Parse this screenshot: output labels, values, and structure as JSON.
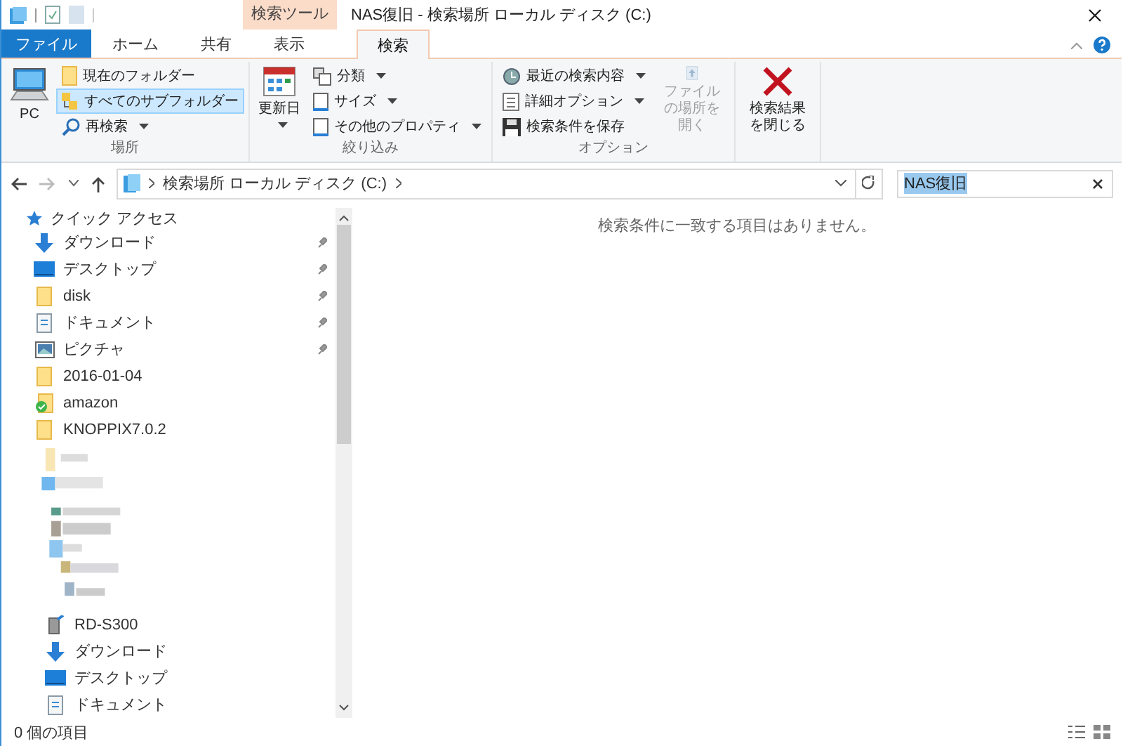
{
  "window": {
    "title": "NAS復旧 - 検索場所 ローカル ディスク (C:)",
    "context_tab": "検索ツール"
  },
  "tabs": [
    {
      "label": "ファイル",
      "kind": "file",
      "selected": false
    },
    {
      "label": "ホーム",
      "kind": "normal",
      "selected": false
    },
    {
      "label": "共有",
      "kind": "normal",
      "selected": false
    },
    {
      "label": "表示",
      "kind": "normal",
      "selected": false
    },
    {
      "label": "検索",
      "kind": "context",
      "selected": true
    }
  ],
  "ribbon": {
    "groups": [
      {
        "label": "場所",
        "buttons": [
          {
            "label": "PC",
            "kind": "large",
            "dropdown": false,
            "selected": false,
            "disabled": false
          },
          {
            "label": "現在のフォルダー",
            "kind": "small",
            "dropdown": false,
            "selected": false,
            "disabled": false
          },
          {
            "label": "すべてのサブフォルダー",
            "kind": "small",
            "dropdown": false,
            "selected": true,
            "disabled": false
          },
          {
            "label": "再検索",
            "kind": "small",
            "dropdown": true,
            "selected": false,
            "disabled": false
          }
        ]
      },
      {
        "label": "絞り込み",
        "buttons": [
          {
            "label": "更新日",
            "kind": "large",
            "dropdown": true,
            "selected": false,
            "disabled": false
          },
          {
            "label": "分類",
            "kind": "small",
            "dropdown": true,
            "selected": false,
            "disabled": false
          },
          {
            "label": "サイズ",
            "kind": "small",
            "dropdown": true,
            "selected": false,
            "disabled": false
          },
          {
            "label": "その他のプロパティ",
            "kind": "small",
            "dropdown": true,
            "selected": false,
            "disabled": false
          }
        ]
      },
      {
        "label": "オプション",
        "buttons": [
          {
            "label": "最近の検索内容",
            "kind": "small",
            "dropdown": true,
            "selected": false,
            "disabled": false
          },
          {
            "label": "詳細オプション",
            "kind": "small",
            "dropdown": true,
            "selected": false,
            "disabled": false
          },
          {
            "label": "検索条件を保存",
            "kind": "small",
            "dropdown": false,
            "selected": false,
            "disabled": false
          },
          {
            "label": "ファイルの場所を開く",
            "kind": "large",
            "dropdown": false,
            "selected": false,
            "disabled": true
          }
        ]
      },
      {
        "buttons": [
          {
            "label": "検索結果を閉じる",
            "kind": "large",
            "dropdown": false,
            "selected": false,
            "disabled": false
          }
        ]
      }
    ]
  },
  "address_bar": {
    "path": "検索場所 ローカル ディスク (C:)",
    "search_value": "NAS復旧"
  },
  "nav_pane": {
    "quick_access": {
      "label": "クイック アクセス",
      "children": [
        {
          "label": "ダウンロード",
          "kind": "download",
          "pinned": true
        },
        {
          "label": "デスクトップ",
          "kind": "desktop",
          "pinned": true
        },
        {
          "label": "disk",
          "kind": "folder",
          "pinned": true
        },
        {
          "label": "ドキュメント",
          "kind": "document",
          "pinned": true
        },
        {
          "label": "ピクチャ",
          "kind": "pictures",
          "pinned": true
        },
        {
          "label": "2016-01-04",
          "kind": "folder",
          "pinned": false
        },
        {
          "label": "amazon",
          "kind": "synced",
          "pinned": false
        },
        {
          "label": "KNOPPIX7.0.2",
          "kind": "folder",
          "pinned": false
        }
      ]
    },
    "lower_items": [
      {
        "label": "RD-S300",
        "kind": "nas"
      },
      {
        "label": "ダウンロード",
        "kind": "download"
      },
      {
        "label": "デスクトップ",
        "kind": "desktop"
      },
      {
        "label": "ドキュメント",
        "kind": "document"
      }
    ]
  },
  "content": {
    "message": "検索条件に一致する項目はありません。"
  },
  "status_bar": {
    "item_count": "0 個の項目"
  }
}
